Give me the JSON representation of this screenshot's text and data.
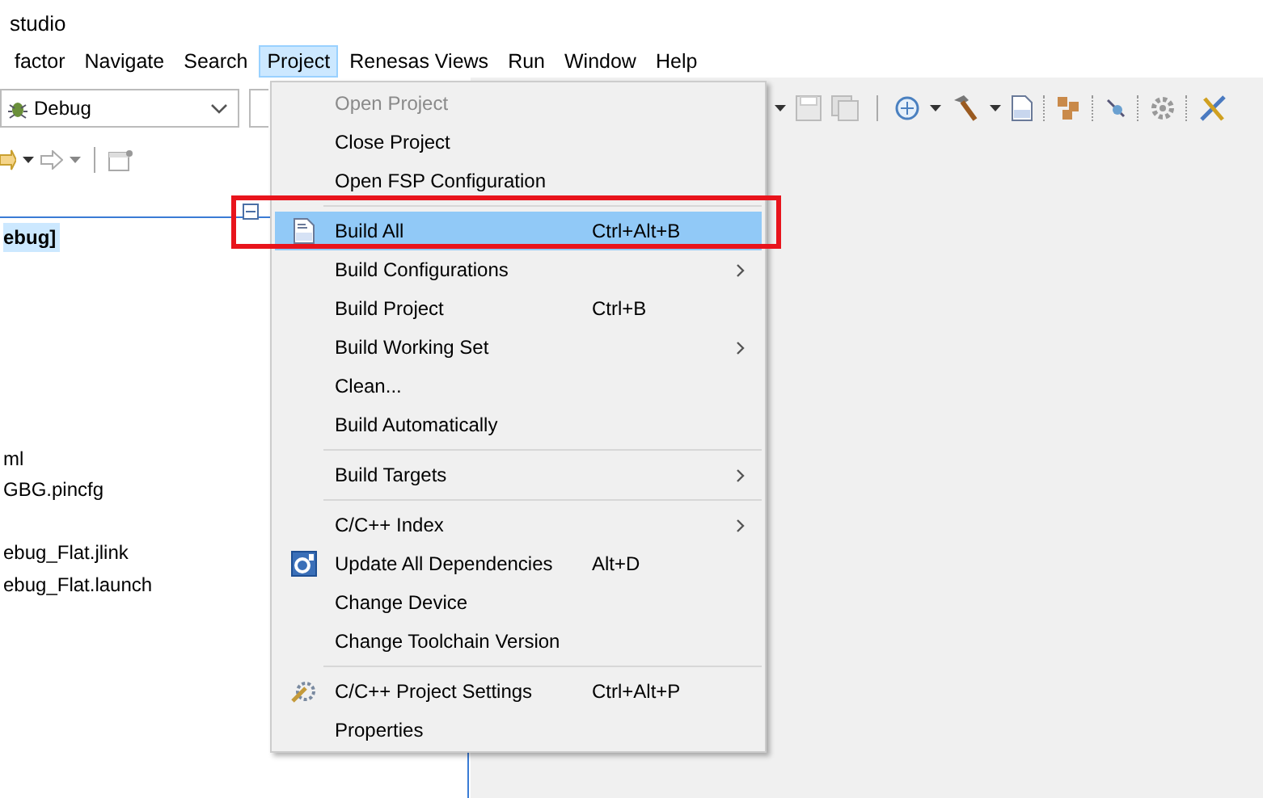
{
  "window": {
    "title": "studio"
  },
  "menu_bar": [
    {
      "label": "factor",
      "selected": false
    },
    {
      "label": "Navigate",
      "selected": false
    },
    {
      "label": "Search",
      "selected": false
    },
    {
      "label": "Project",
      "selected": true
    },
    {
      "label": "Renesas Views",
      "selected": false
    },
    {
      "label": "Run",
      "selected": false
    },
    {
      "label": "Window",
      "selected": false
    },
    {
      "label": "Help",
      "selected": false
    }
  ],
  "config_combo": {
    "value": "Debug"
  },
  "project_tree": [
    {
      "label": "ebug]",
      "selected": true
    },
    {
      "label": "ml",
      "selected": false
    },
    {
      "label": "GBG.pincfg",
      "selected": false
    },
    {
      "label": "ebug_Flat.jlink",
      "selected": false
    },
    {
      "label": "ebug_Flat.launch",
      "selected": false
    }
  ],
  "project_menu": [
    {
      "kind": "item",
      "label": "Open Project",
      "disabled": true,
      "selected": false,
      "submenu": false
    },
    {
      "kind": "item",
      "label": "Close Project",
      "disabled": false,
      "selected": false,
      "submenu": false
    },
    {
      "kind": "item",
      "label": "Open FSP Configuration",
      "disabled": false,
      "selected": false,
      "submenu": false
    },
    {
      "kind": "separator"
    },
    {
      "kind": "item",
      "label": "Build All",
      "shortcut": "Ctrl+Alt+B",
      "disabled": false,
      "selected": true,
      "submenu": false
    },
    {
      "kind": "item",
      "label": "Build Configurations",
      "disabled": false,
      "selected": false,
      "submenu": true
    },
    {
      "kind": "item",
      "label": "Build Project",
      "shortcut": "Ctrl+B",
      "disabled": false,
      "selected": false,
      "submenu": false
    },
    {
      "kind": "item",
      "label": "Build Working Set",
      "disabled": false,
      "selected": false,
      "submenu": true
    },
    {
      "kind": "item",
      "label": "Clean...",
      "disabled": false,
      "selected": false,
      "submenu": false
    },
    {
      "kind": "item",
      "label": "Build Automatically",
      "disabled": false,
      "selected": false,
      "submenu": false
    },
    {
      "kind": "separator"
    },
    {
      "kind": "item",
      "label": "Build Targets",
      "disabled": false,
      "selected": false,
      "submenu": true
    },
    {
      "kind": "separator"
    },
    {
      "kind": "item",
      "label": "C/C++ Index",
      "disabled": false,
      "selected": false,
      "submenu": true
    },
    {
      "kind": "item",
      "label": "Update All Dependencies",
      "shortcut": "Alt+D",
      "disabled": false,
      "selected": false,
      "submenu": false
    },
    {
      "kind": "item",
      "label": "Change Device",
      "disabled": false,
      "selected": false,
      "submenu": false
    },
    {
      "kind": "item",
      "label": "Change Toolchain Version",
      "disabled": false,
      "selected": false,
      "submenu": false
    },
    {
      "kind": "separator"
    },
    {
      "kind": "item",
      "label": "C/C++ Project Settings",
      "shortcut": "Ctrl+Alt+P",
      "disabled": false,
      "selected": false,
      "submenu": false
    },
    {
      "kind": "item",
      "label": "Properties",
      "disabled": false,
      "selected": false,
      "submenu": false
    }
  ]
}
